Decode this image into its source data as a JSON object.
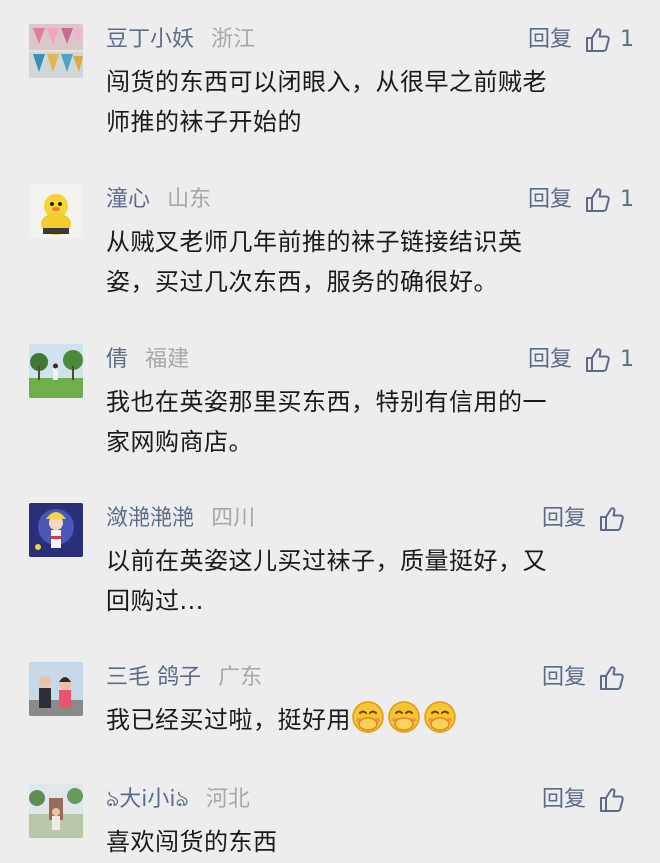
{
  "reply_label": "回复",
  "icons": {
    "like": "thumbs-up-icon"
  },
  "colors": {
    "background": "#ededed",
    "name": "#5c6b8a",
    "region": "#a8a8a8",
    "text": "#1a1a1a"
  },
  "comments": [
    {
      "name": "豆丁小妖",
      "region": "浙江",
      "likes": "1",
      "text": "闯货的东西可以闭眼入，从很早之前贼老\n师推的袜子开始的"
    },
    {
      "name": "潼心",
      "region": "山东",
      "likes": "1",
      "text": "从贼叉老师几年前推的袜子链接结识英\n姿，买过几次东西，服务的确很好。"
    },
    {
      "name": "倩",
      "region": "福建",
      "likes": "1",
      "text": "我也在英姿那里买东西，特别有信用的一\n家网购商店。"
    },
    {
      "name": "潋滟滟滟",
      "region": "四川",
      "likes": "",
      "text": "以前在英姿这儿买过袜子，质量挺好，又\n回购过..."
    },
    {
      "name": "三毛 鸽子",
      "region": "广东",
      "likes": "",
      "text": "我已经买过啦，挺好用"
    },
    {
      "name": "ঌ大i小iঌ",
      "region": "河北",
      "likes": "",
      "text": "喜欢闯货的东西"
    }
  ]
}
